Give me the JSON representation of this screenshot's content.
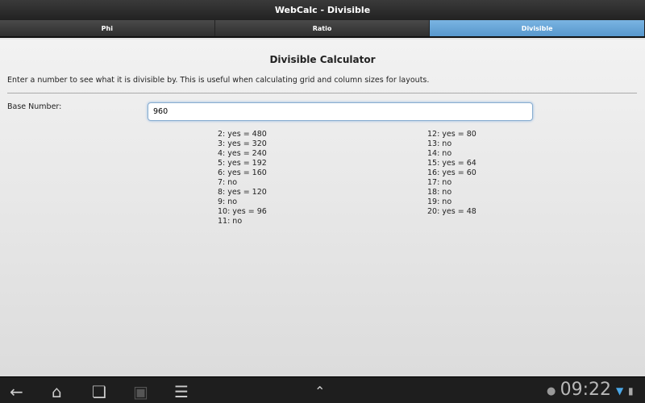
{
  "title": "WebCalc - Divisible",
  "tabs": [
    {
      "label": "Phi"
    },
    {
      "label": "Ratio"
    },
    {
      "label": "Divisible"
    }
  ],
  "heading": "Divisible Calculator",
  "description": "Enter a number to see what it is divisible by. This is useful when calculating grid and column sizes for layouts.",
  "base_label": "Base Number:",
  "base_value": "960",
  "results_left": [
    "2: yes = 480",
    "3: yes = 320",
    "4: yes = 240",
    "5: yes = 192",
    "6: yes = 160",
    "7: no",
    "8: yes = 120",
    "9: no",
    "10: yes = 96",
    "11: no"
  ],
  "results_right": [
    "12: yes = 80",
    "13: no",
    "14: no",
    "15: yes = 64",
    "16: yes = 60",
    "17: no",
    "18: no",
    "19: no",
    "20: yes = 48"
  ],
  "clock": "09:22"
}
